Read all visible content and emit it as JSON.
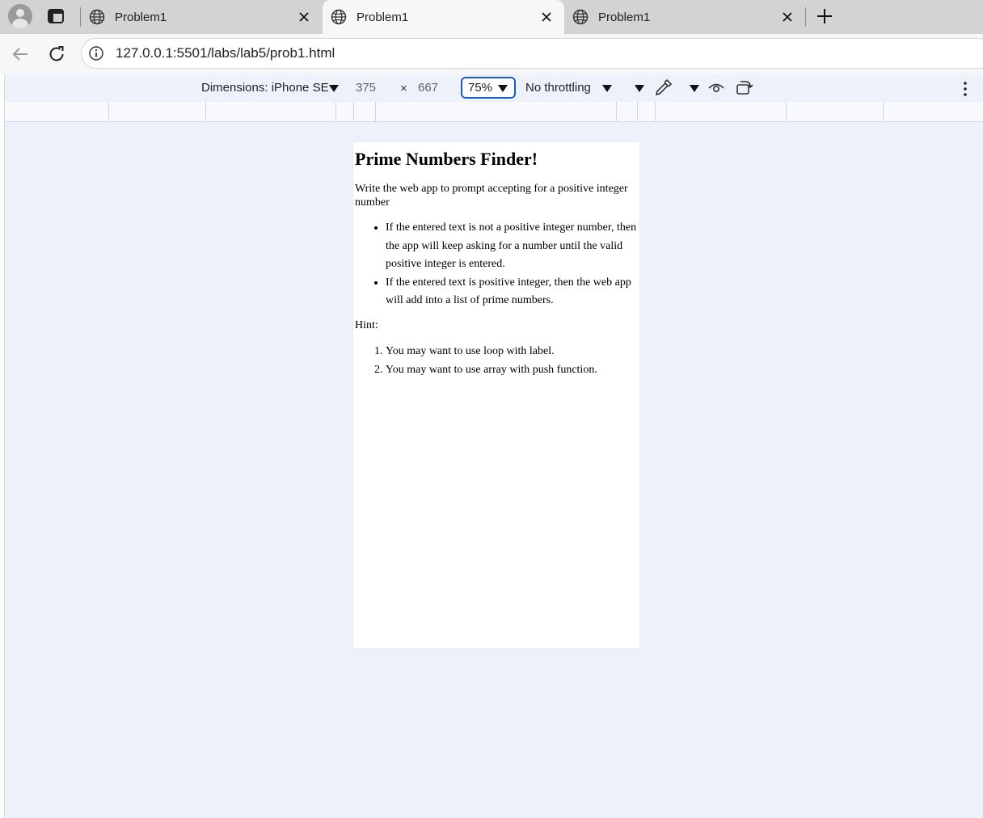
{
  "browser": {
    "tabs": [
      {
        "title": "Problem1",
        "active": false
      },
      {
        "title": "Problem1",
        "active": true
      },
      {
        "title": "Problem1",
        "active": false
      }
    ],
    "url": "127.0.0.1:5501/labs/lab5/prob1.html"
  },
  "devtools": {
    "dimensions_label": "Dimensions: iPhone SE",
    "width": "375",
    "times": "×",
    "height": "667",
    "zoom": "75%",
    "throttling": "No throttling"
  },
  "page": {
    "title": "Prime Numbers Finder!",
    "description": "Write the web app to prompt accepting for a positive integer number",
    "bullets": [
      "If the entered text is not a positive integer number, then the app will keep asking for a number until the valid positive integer is entered.",
      "If the entered text is positive integer, then the web app will add into a list of prime numbers."
    ],
    "hint_label": "Hint:",
    "hints": [
      "You may want to use loop with label.",
      "You may want to use array with push function."
    ]
  },
  "colors": {
    "tabstrip_bg": "#d3d3d3",
    "active_tab_bg": "#f7f7f7",
    "devtools_bg": "#edf1f9",
    "zoom_border": "#1a5bc4"
  },
  "icons": [
    "avatar-icon",
    "tab-actions-icon",
    "globe-icon",
    "close-icon",
    "new-tab-icon",
    "back-icon",
    "reload-icon",
    "info-icon",
    "caret-down-icon",
    "eyedropper-icon",
    "eye-icon",
    "rotate-icon",
    "more-vertical-icon"
  ]
}
